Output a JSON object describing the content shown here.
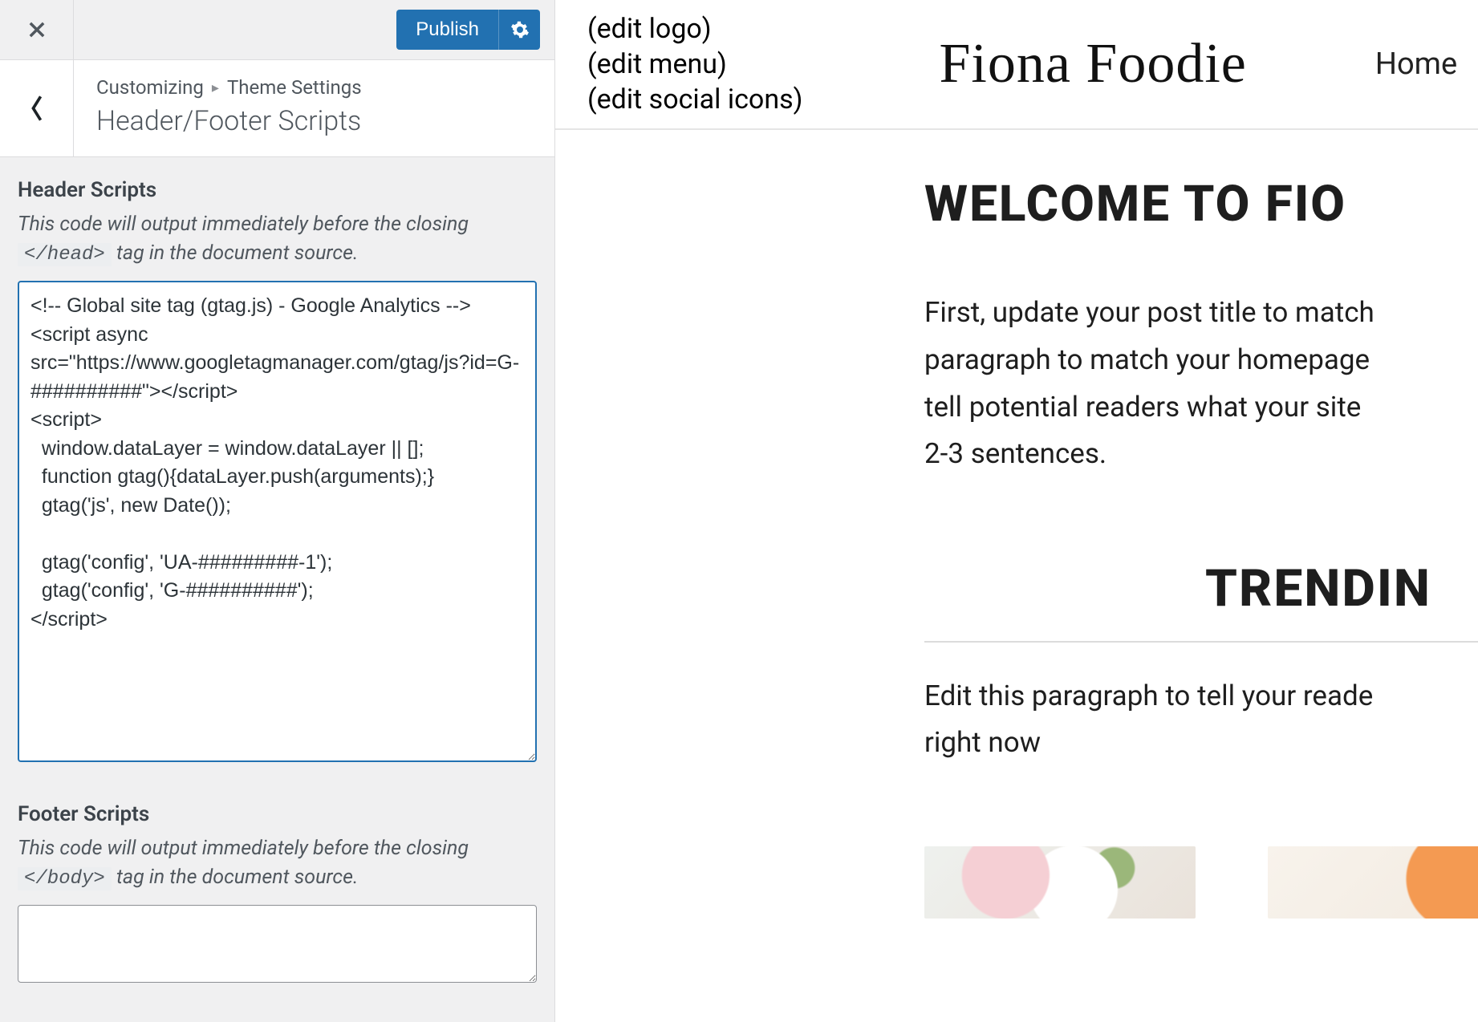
{
  "top": {
    "publish_label": "Publish"
  },
  "breadcrumb": {
    "root": "Customizing",
    "section": "Theme Settings",
    "title": "Header/Footer Scripts"
  },
  "header_scripts": {
    "heading": "Header Scripts",
    "desc_before": "This code will output immediately before the closing ",
    "tag_text": "</head>",
    "desc_after": " tag in the document source.",
    "value": "<!-- Global site tag (gtag.js) - Google Analytics -->\n<script async src=\"https://www.googletagmanager.com/gtag/js?id=G-##########\"></script>\n<script>\n  window.dataLayer = window.dataLayer || [];\n  function gtag(){dataLayer.push(arguments);}\n  gtag('js', new Date());\n\n  gtag('config', 'UA-#########-1');\n  gtag('config', 'G-##########');\n</script>\n"
  },
  "footer_scripts": {
    "heading": "Footer Scripts",
    "desc_before": "This code will output immediately before the closing ",
    "tag_text": "</body>",
    "desc_after": " tag in the document source.",
    "value": ""
  },
  "preview": {
    "edits": {
      "logo": "(edit logo)",
      "menu": "(edit menu)",
      "social": "(edit social icons)"
    },
    "logo_text": "Fiona Foodie",
    "nav_home": "Home",
    "welcome": "WELCOME TO FIO",
    "paragraph1_l1": "First, update your post title to match",
    "paragraph1_l2": "paragraph to match your homepage",
    "paragraph1_l3": "tell potential readers what your site ",
    "paragraph1_l4": "2-3 sentences.",
    "trending": "TRENDIN",
    "paragraph2_l1": "Edit this paragraph to tell your reade",
    "paragraph2_l2": "right now"
  }
}
